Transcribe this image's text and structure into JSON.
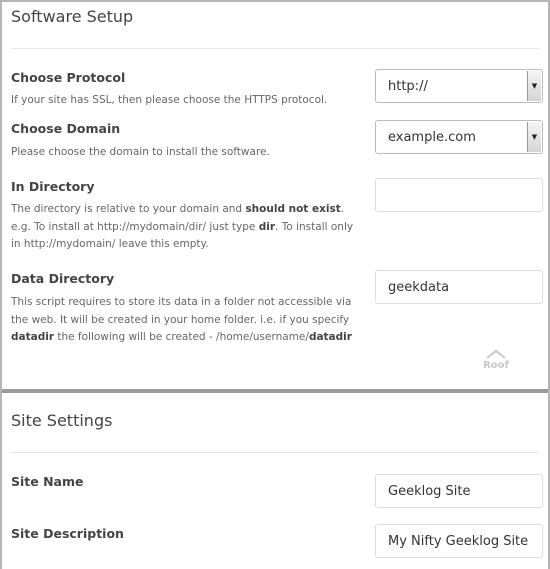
{
  "software_setup": {
    "title": "Software Setup",
    "protocol": {
      "label": "Choose Protocol",
      "desc": "If your site has SSL, then please choose the HTTPS protocol.",
      "value": "http://"
    },
    "domain": {
      "label": "Choose Domain",
      "desc": "Please choose the domain to install the software.",
      "value": "example.com"
    },
    "directory": {
      "label": "In Directory",
      "desc1": "The directory is relative to your domain and ",
      "desc_b1": "should not exist",
      "desc2": ". e.g. To install at http://mydomain/dir/ just type ",
      "desc_b2": "dir",
      "desc3": ". To install only in http://mydomain/ leave this empty.",
      "value": ""
    },
    "data_directory": {
      "label": "Data Directory",
      "desc1": "This script requires to store its data in a folder not accessible via the web. It will be created in your home folder. i.e. if you specify ",
      "desc_b1": "datadir",
      "desc2": " the following will be created - /home/username/",
      "desc_b2": "datadir",
      "value": "geekdata"
    },
    "logo": "Website Roof"
  },
  "site_settings": {
    "title": "Site Settings",
    "site_name": {
      "label": "Site Name",
      "value": "Geeklog Site"
    },
    "site_description": {
      "label": "Site Description",
      "value": "My Nifty Geeklog Site"
    }
  }
}
